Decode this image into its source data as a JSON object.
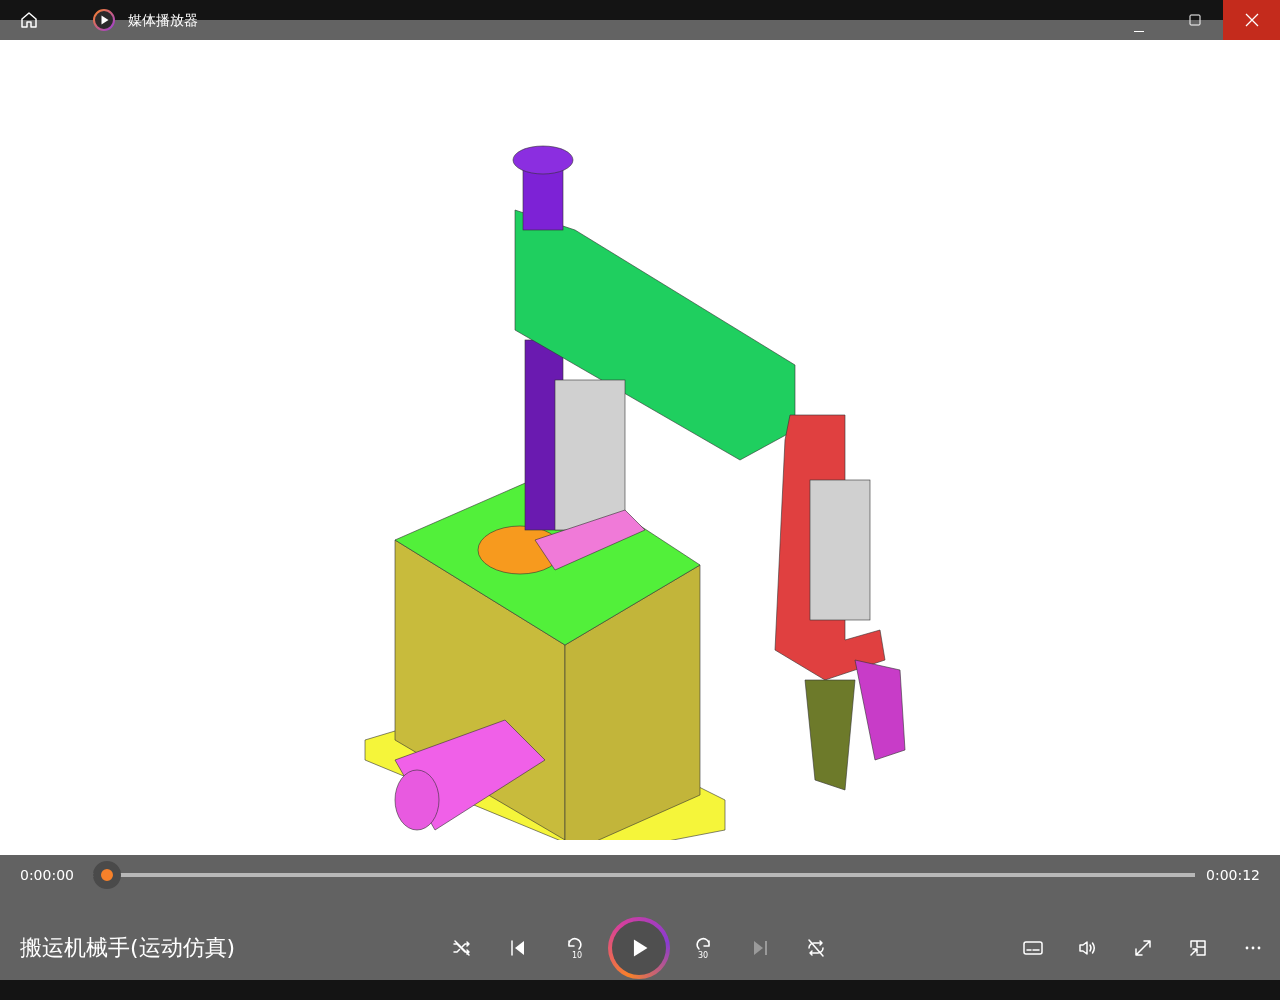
{
  "window": {
    "title": "媒体播放器"
  },
  "progress": {
    "elapsed": "0:00:00",
    "total": "0:00:12",
    "level": 0
  },
  "now_playing": {
    "title": "搬运机械手(运动仿真)"
  },
  "center_controls": [
    {
      "kind": "shuffle",
      "disabled": false
    },
    {
      "kind": "previous",
      "disabled": false
    },
    {
      "kind": "back10",
      "label": "10",
      "disabled": false
    },
    {
      "kind": "play",
      "disabled": false
    },
    {
      "kind": "forward30",
      "label": "30",
      "disabled": false
    },
    {
      "kind": "next",
      "disabled": true
    },
    {
      "kind": "repeat",
      "disabled": false
    }
  ],
  "right_controls": [
    {
      "kind": "subtitles"
    },
    {
      "kind": "volume"
    },
    {
      "kind": "fullscreen"
    },
    {
      "kind": "miniplayer"
    },
    {
      "kind": "more"
    }
  ]
}
